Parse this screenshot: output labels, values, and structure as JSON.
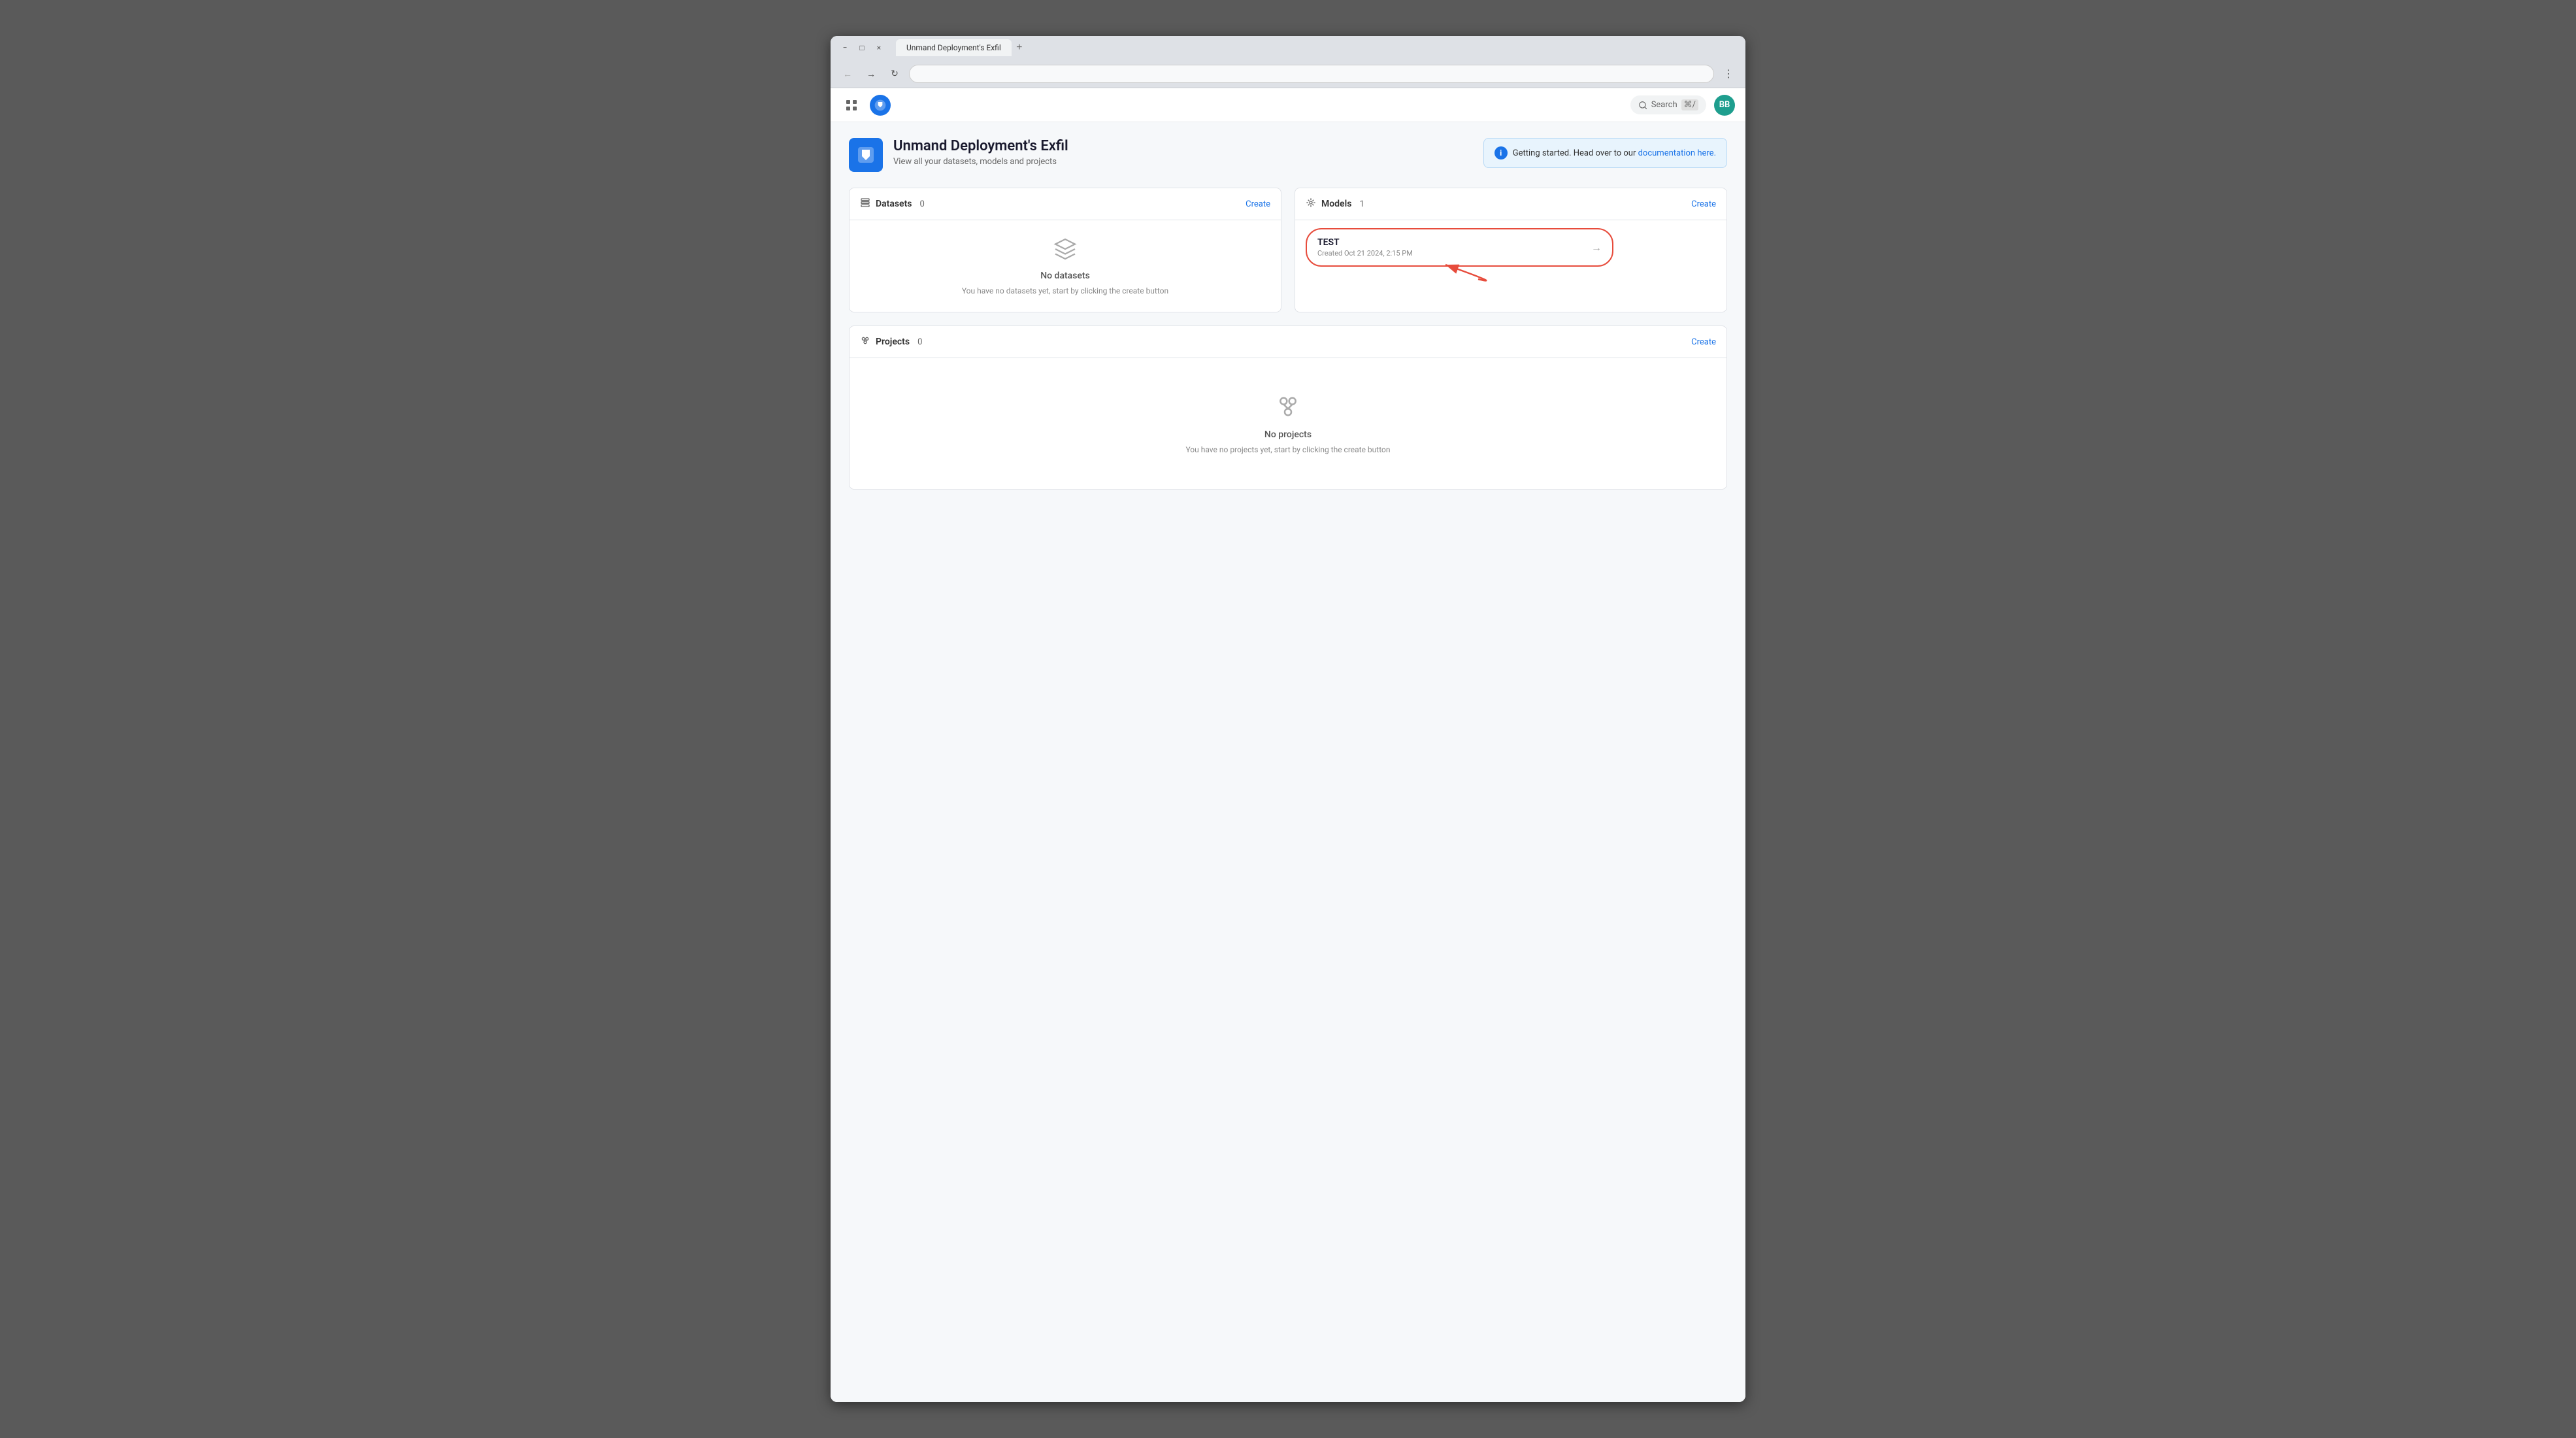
{
  "browser": {
    "tab_label": "Unmand Deployment's Exfil",
    "new_tab_icon": "+",
    "address": "",
    "controls": {
      "minimize": "−",
      "maximize": "□",
      "close": "×"
    }
  },
  "toolbar": {
    "search_label": "Search",
    "search_shortcut": "⌘/",
    "user_initials": "BB"
  },
  "page": {
    "org_name": "Unmand Deployment's Exfil",
    "org_subtitle": "View all your datasets, models and projects",
    "info_banner": {
      "text": "Getting started. Head over to our ",
      "link_text": "documentation here."
    }
  },
  "datasets_section": {
    "title": "Datasets",
    "count": "0",
    "create_label": "Create",
    "empty_title": "No datasets",
    "empty_subtitle": "You have no datasets yet, start by clicking the create button"
  },
  "models_section": {
    "title": "Models",
    "count": "1",
    "create_label": "Create",
    "model": {
      "name": "TEST",
      "created": "Created Oct 21 2024, 2:15 PM"
    }
  },
  "projects_section": {
    "title": "Projects",
    "count": "0",
    "create_label": "Create",
    "empty_title": "No projects",
    "empty_subtitle": "You have no projects yet, start by clicking the create button"
  },
  "colors": {
    "accent": "#1a73e8",
    "danger": "#e74c3c",
    "teal": "#1e9e8e"
  }
}
